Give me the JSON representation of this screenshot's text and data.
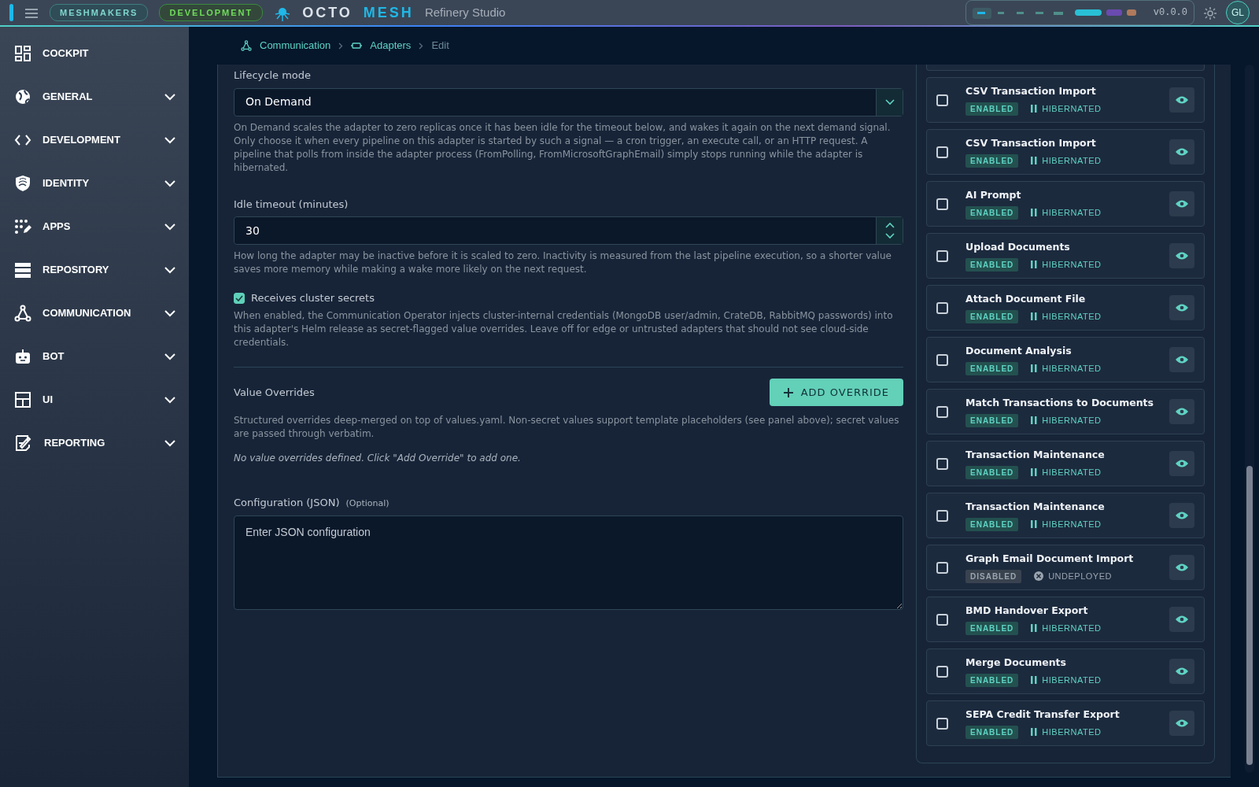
{
  "header": {
    "org_badge": "MESHMAKERS",
    "env_badge": "DEVELOPMENT",
    "brand_first": "OCTO",
    "brand_second": "MESH",
    "product": "Refinery Studio",
    "version": "v0.0.0",
    "avatar": "GL"
  },
  "sidebar": {
    "items": [
      {
        "label": "COCKPIT",
        "expandable": false
      },
      {
        "label": "GENERAL",
        "expandable": true
      },
      {
        "label": "DEVELOPMENT",
        "expandable": true
      },
      {
        "label": "IDENTITY",
        "expandable": true
      },
      {
        "label": "APPS",
        "expandable": true
      },
      {
        "label": "REPOSITORY",
        "expandable": true
      },
      {
        "label": "COMMUNICATION",
        "expandable": true
      },
      {
        "label": "BOT",
        "expandable": true
      },
      {
        "label": "UI",
        "expandable": true
      },
      {
        "label": "REPORTING",
        "expandable": true
      }
    ]
  },
  "breadcrumb": [
    {
      "label": "Communication",
      "current": false
    },
    {
      "label": "Adapters",
      "current": false
    },
    {
      "label": "Edit",
      "current": true
    }
  ],
  "form": {
    "lifecycle": {
      "label": "Lifecycle mode",
      "value": "On Demand",
      "help": "On Demand scales the adapter to zero replicas once it has been idle for the timeout below, and wakes it again on the next demand signal. Only choose it when every pipeline on this adapter is started by such a signal — a cron trigger, an execute call, or an HTTP request. A pipeline that polls from inside the adapter process (FromPolling, FromMicrosoftGraphEmail) simply stops running while the adapter is hibernated."
    },
    "idle_timeout": {
      "label": "Idle timeout (minutes)",
      "value": "30",
      "help": "How long the adapter may be inactive before it is scaled to zero. Inactivity is measured from the last pipeline execution, so a shorter value saves more memory while making a wake more likely on the next request."
    },
    "cluster_secrets": {
      "label": "Receives cluster secrets",
      "checked": true,
      "help": "When enabled, the Communication Operator injects cluster-internal credentials (MongoDB user/admin, CrateDB, RabbitMQ passwords) into this adapter's Helm release as secret-flagged value overrides. Leave off for edge or untrusted adapters that should not see cloud-side credentials."
    },
    "value_overrides": {
      "title": "Value Overrides",
      "button": "ADD OVERRIDE",
      "help": "Structured overrides deep-merged on top of values.yaml. Non-secret values support template placeholders (see panel above); secret values are passed through verbatim.",
      "empty": "No value overrides defined. Click \"Add Override\" to add one."
    },
    "configuration": {
      "label": "Configuration (JSON)",
      "hint": "(Optional)",
      "placeholder": "Enter JSON configuration"
    }
  },
  "pipelines": [
    {
      "name": "CSV Transaction Import",
      "status": "ENABLED",
      "enabled": true,
      "state": "HIBERNATED",
      "kind": "hibernated",
      "checked": false
    },
    {
      "name": "CSV Transaction Import",
      "status": "ENABLED",
      "enabled": true,
      "state": "HIBERNATED",
      "kind": "hibernated",
      "checked": false
    },
    {
      "name": "AI Prompt",
      "status": "ENABLED",
      "enabled": true,
      "state": "HIBERNATED",
      "kind": "hibernated",
      "checked": false
    },
    {
      "name": "Upload Documents",
      "status": "ENABLED",
      "enabled": true,
      "state": "HIBERNATED",
      "kind": "hibernated",
      "checked": false
    },
    {
      "name": "Attach Document File",
      "status": "ENABLED",
      "enabled": true,
      "state": "HIBERNATED",
      "kind": "hibernated",
      "checked": false
    },
    {
      "name": "Document Analysis",
      "status": "ENABLED",
      "enabled": true,
      "state": "HIBERNATED",
      "kind": "hibernated",
      "checked": false
    },
    {
      "name": "Match Transactions to Documents",
      "status": "ENABLED",
      "enabled": true,
      "state": "HIBERNATED",
      "kind": "hibernated",
      "checked": false
    },
    {
      "name": "Transaction Maintenance",
      "status": "ENABLED",
      "enabled": true,
      "state": "HIBERNATED",
      "kind": "hibernated",
      "checked": false
    },
    {
      "name": "Transaction Maintenance",
      "status": "ENABLED",
      "enabled": true,
      "state": "HIBERNATED",
      "kind": "hibernated",
      "checked": false
    },
    {
      "name": "Graph Email Document Import",
      "status": "DISABLED",
      "enabled": false,
      "state": "UNDEPLOYED",
      "kind": "undeployed",
      "checked": false
    },
    {
      "name": "BMD Handover Export",
      "status": "ENABLED",
      "enabled": true,
      "state": "HIBERNATED",
      "kind": "hibernated",
      "checked": false
    },
    {
      "name": "Merge Documents",
      "status": "ENABLED",
      "enabled": true,
      "state": "HIBERNATED",
      "kind": "hibernated",
      "checked": false
    },
    {
      "name": "SEPA Credit Transfer Export",
      "status": "ENABLED",
      "enabled": true,
      "state": "HIBERNATED",
      "kind": "hibernated",
      "checked": false
    }
  ]
}
